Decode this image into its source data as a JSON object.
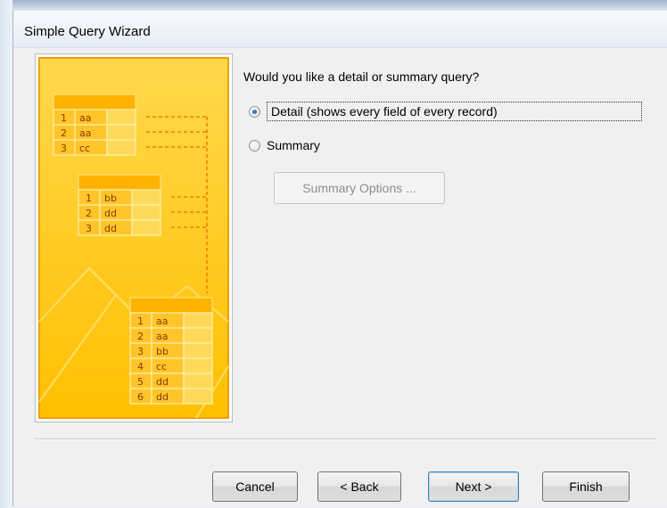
{
  "window": {
    "title": "Simple Query Wizard"
  },
  "main": {
    "question": "Would you like a detail or summary query?",
    "options": [
      {
        "label": "Detail (shows every field of every record)",
        "selected": true
      },
      {
        "label": "Summary",
        "selected": false
      }
    ],
    "summary_options_label": "Summary Options ..."
  },
  "illustration": {
    "table1": [
      [
        "1",
        "aa"
      ],
      [
        "2",
        "aa"
      ],
      [
        "3",
        "cc"
      ]
    ],
    "table2": [
      [
        "1",
        "bb"
      ],
      [
        "2",
        "dd"
      ],
      [
        "3",
        "dd"
      ]
    ],
    "table3": [
      [
        "1",
        "aa"
      ],
      [
        "2",
        "aa"
      ],
      [
        "3",
        "bb"
      ],
      [
        "4",
        "cc"
      ],
      [
        "5",
        "dd"
      ],
      [
        "6",
        "dd"
      ]
    ]
  },
  "footer": {
    "cancel": "Cancel",
    "back": "< Back",
    "next": "Next >",
    "finish": "Finish"
  },
  "colors": {
    "illustration_bg": "#ffc61a",
    "illustration_line": "#f08000"
  }
}
